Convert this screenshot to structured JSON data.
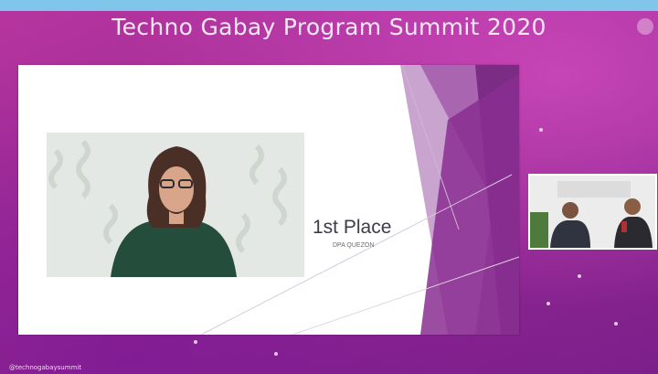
{
  "header": {
    "title": "Techno Gabay Program Summit 2020"
  },
  "slide": {
    "place_title": "1st Place",
    "place_subtitle": "DPA QUEZON"
  },
  "footer": {
    "handle": "@technogabaysummit"
  },
  "colors": {
    "background": "#a32a92",
    "slide_accent": "#8a2e92",
    "top_strip": "#7fc6ea"
  }
}
